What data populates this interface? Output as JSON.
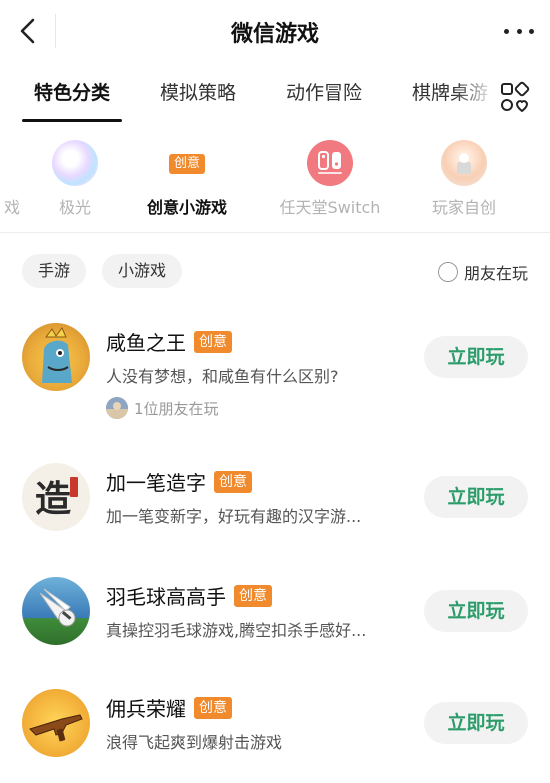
{
  "header": {
    "title": "微信游戏"
  },
  "tabs": [
    {
      "label": "特色分类"
    },
    {
      "label": "模拟策略"
    },
    {
      "label": "动作冒险"
    },
    {
      "label": "棋牌桌游"
    }
  ],
  "subcats": [
    {
      "label": "极光"
    },
    {
      "label": "创意小游戏",
      "badge": "创意"
    },
    {
      "label": "任天堂Switch"
    },
    {
      "label": "玩家自创"
    }
  ],
  "filters": {
    "chips": [
      "手游",
      "小游戏"
    ],
    "friends_toggle": "朋友在玩"
  },
  "games": [
    {
      "name": "咸鱼之王",
      "badge": "创意",
      "desc": "人没有梦想，和咸鱼有什么区别?",
      "friends": "1位朋友在玩",
      "play": "立即玩"
    },
    {
      "name": "加一笔造字",
      "badge": "创意",
      "desc": "加一笔变新字，好玩有趣的汉字游...",
      "play": "立即玩"
    },
    {
      "name": "羽毛球高高手",
      "badge": "创意",
      "desc": "真操控羽毛球游戏,腾空扣杀手感好...",
      "play": "立即玩"
    },
    {
      "name": "佣兵荣耀",
      "badge": "创意",
      "desc": "浪得飞起爽到爆射击游戏",
      "play": "立即玩"
    }
  ],
  "colors": {
    "accent_green": "#2c9c6b",
    "badge_orange": "#f08a2c"
  }
}
